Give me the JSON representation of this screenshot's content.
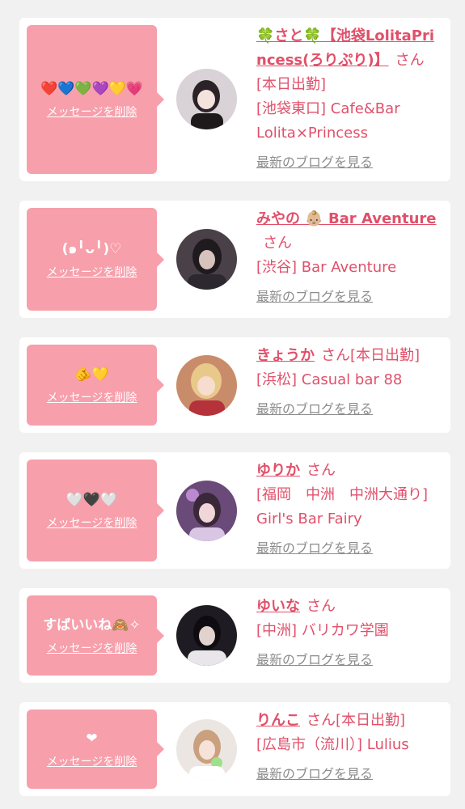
{
  "colors": {
    "bubble": "#f79fab",
    "accent": "#e0506a",
    "muted": "#8c8c8c",
    "background": "#f1f1f1"
  },
  "messages": [
    {
      "message": "❤️💙💚💜💛💗",
      "delete_label": "メッセージを削除",
      "name": "🍀さと🍀【池袋LolitaPrincess(ろりぷり)】",
      "san": "さん",
      "status": "[本日出勤]",
      "shop": "[池袋東口] Cafe&Bar Lolita×Princess",
      "blog_label": "最新のブログを見る",
      "avatar_bg": "#d9d2d6"
    },
    {
      "message": "(๑╹ᴗ╹)♡",
      "delete_label": "メッセージを削除",
      "name": "みやの 👶🏼 Bar Aventure",
      "san": "さん",
      "status": "",
      "shop": "[渋谷] Bar Aventure",
      "blog_label": "最新のブログを見る",
      "avatar_bg": "#4a4048"
    },
    {
      "message": "🫵💛",
      "delete_label": "メッセージを削除",
      "name": "きょうか",
      "san": "さん",
      "status": "[本日出勤]",
      "shop": "[浜松] Casual bar 88",
      "blog_label": "最新のブログを見る",
      "avatar_bg": "#c98c6a"
    },
    {
      "message": "🤍🖤🤍",
      "delete_label": "メッセージを削除",
      "name": "ゆりか",
      "san": "さん",
      "status": "",
      "shop": "[福岡　中洲　中洲大通り] Girl's Bar Fairy",
      "blog_label": "最新のブログを見る",
      "avatar_bg": "#6a4a78"
    },
    {
      "message": "すばいいね🙈✧",
      "delete_label": "メッセージを削除",
      "name": "ゆいな",
      "san": "さん",
      "status": "",
      "shop": "[中洲] バリカワ学園",
      "blog_label": "最新のブログを見る",
      "avatar_bg": "#1e1c22"
    },
    {
      "message": "❤︎",
      "delete_label": "メッセージを削除",
      "name": "りんこ",
      "san": "さん",
      "status": "[本日出勤]",
      "shop": "[広島市（流川）] Lulius",
      "blog_label": "最新のブログを見る",
      "avatar_bg": "#ece6e2"
    }
  ]
}
